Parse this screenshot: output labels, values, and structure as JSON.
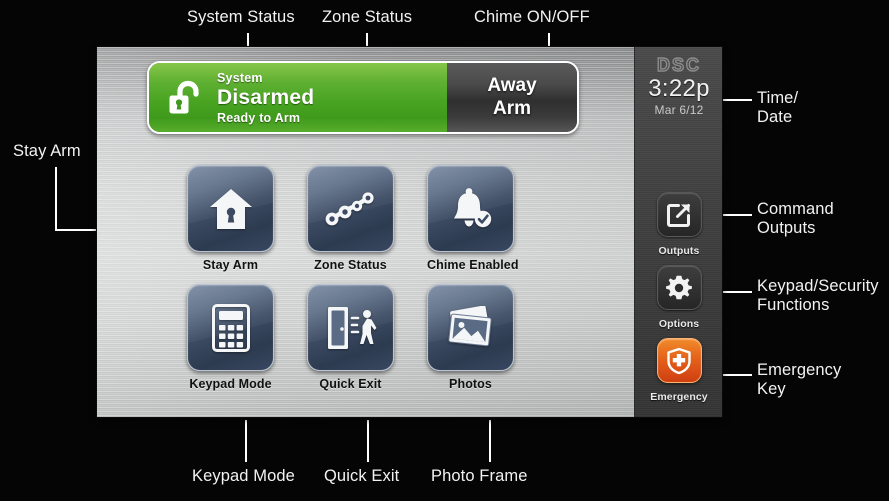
{
  "annotations": {
    "top": [
      {
        "label": "System Status"
      },
      {
        "label": "Zone Status"
      },
      {
        "label": "Chime ON/OFF"
      }
    ],
    "left": [
      {
        "label": "Stay Arm"
      }
    ],
    "right": [
      {
        "label": "Time/\nDate"
      },
      {
        "label": "Command\nOutputs"
      },
      {
        "label": "Keypad/Security\nFunctions"
      },
      {
        "label": "Emergency\nKey"
      }
    ],
    "bottom": [
      {
        "label": "Keypad Mode"
      },
      {
        "label": "Quick Exit"
      },
      {
        "label": "Photo Frame"
      }
    ]
  },
  "device": {
    "status_bar": {
      "icon": "unlocked-padlock-icon",
      "system_label": "System",
      "state": "Disarmed",
      "ready_text": "Ready to Arm",
      "arm_button": "Away\nArm",
      "green_color": "#47a320",
      "dark_color": "#3b3b3b"
    },
    "grid": {
      "row1": [
        {
          "icon": "house-keyhole-icon",
          "label": "Stay Arm"
        },
        {
          "icon": "zone-sensors-icon",
          "label": "Zone Status"
        },
        {
          "icon": "bell-check-icon",
          "label": "Chime Enabled"
        }
      ],
      "row2": [
        {
          "icon": "keypad-icon",
          "label": "Keypad Mode"
        },
        {
          "icon": "door-exit-person-icon",
          "label": "Quick Exit"
        },
        {
          "icon": "photo-stack-icon",
          "label": "Photos"
        }
      ]
    },
    "sidebar": {
      "brand": "DSC",
      "time": "3:22p",
      "date": "Mar 6/12",
      "buttons": [
        {
          "icon": "arrow-out-of-box-icon",
          "label": "Outputs"
        },
        {
          "icon": "gear-icon",
          "label": "Options"
        },
        {
          "icon": "shield-cross-icon",
          "label": "Emergency",
          "color": "#e4601a"
        }
      ]
    }
  }
}
